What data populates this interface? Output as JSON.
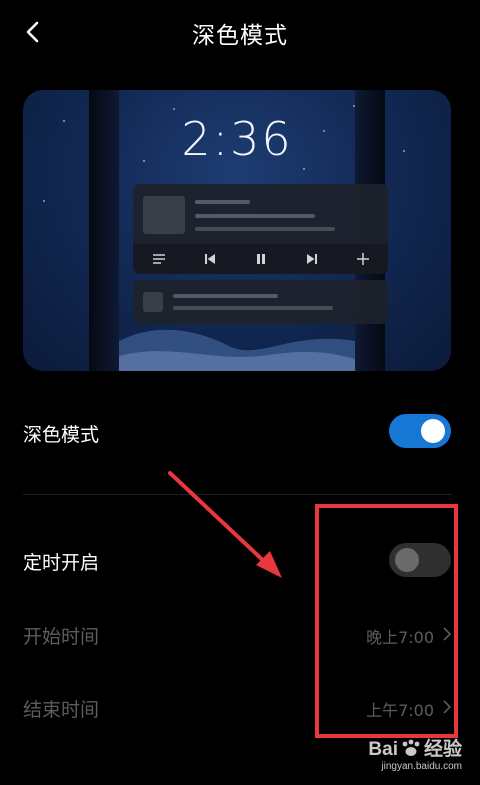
{
  "header": {
    "title": "深色模式"
  },
  "preview": {
    "clock": "2:36"
  },
  "dark_mode": {
    "label": "深色模式",
    "enabled": true
  },
  "schedule": {
    "label": "定时开启",
    "enabled": false
  },
  "start_time": {
    "label": "开始时间",
    "value": "晚上7:00"
  },
  "end_time": {
    "label": "结束时间",
    "value": "上午7:00"
  },
  "watermark": {
    "brand_left": "Bai",
    "brand_right": "经验",
    "url": "jingyan.baidu.com"
  },
  "colors": {
    "accent": "#1677d4",
    "highlight": "#e8383d"
  },
  "icons": [
    "back-icon",
    "menu-icon",
    "previous-icon",
    "pause-icon",
    "next-icon",
    "plus-icon",
    "chevron-right-icon"
  ]
}
